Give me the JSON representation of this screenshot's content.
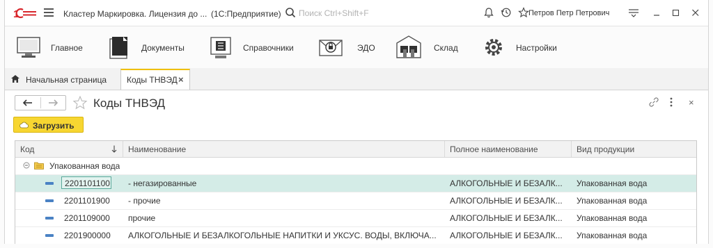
{
  "app": {
    "title": "Кластер Маркировка. Лицензия до ...",
    "subtitle": "(1С:Предприятие)",
    "search_placeholder": "Поиск Ctrl+Shift+F",
    "user": "Петров Петр Петрович"
  },
  "sections": [
    {
      "label": "Главное",
      "icon": "desktop-icon"
    },
    {
      "label": "Документы",
      "icon": "documents-icon"
    },
    {
      "label": "Справочники",
      "icon": "catalogs-icon"
    },
    {
      "label": "ЭДО",
      "icon": "edo-icon"
    },
    {
      "label": "Склад",
      "icon": "warehouse-icon"
    },
    {
      "label": "Настройки",
      "icon": "settings-gear-icon"
    }
  ],
  "tabs": {
    "home": "Начальная страница",
    "active": "Коды ТНВЭД",
    "close": "×"
  },
  "form": {
    "title": "Коды ТНВЭД",
    "load_button": "Загрузить",
    "close": "×"
  },
  "table": {
    "columns": [
      "Код",
      "Наименование",
      "Полное наименование",
      "Вид продукции"
    ],
    "group": "Упакованная вода",
    "rows": [
      {
        "code": "2201101100",
        "name": "- негазированные",
        "full": "АЛКОГОЛЬНЫЕ И БЕЗАЛК...",
        "kind": "Упакованная вода"
      },
      {
        "code": "2201101900",
        "name": "- прочие",
        "full": "АЛКОГОЛЬНЫЕ И БЕЗАЛК...",
        "kind": "Упакованная вода"
      },
      {
        "code": "2201109000",
        "name": "прочие",
        "full": "АЛКОГОЛЬНЫЕ И БЕЗАЛК...",
        "kind": "Упакованная вода"
      },
      {
        "code": "2201900000",
        "name": "АЛКОГОЛЬНЫЕ И БЕЗАЛКОГОЛЬНЫЕ НАПИТКИ И УКСУС. ВОДЫ, ВКЛЮЧА...",
        "full": "АЛКОГОЛЬНЫЕ И БЕЗАЛК...",
        "kind": "Упакованная вода"
      }
    ]
  },
  "colors": {
    "accent": "#f7d631",
    "selected_row": "#d4ece7",
    "logo_red": "#d8252b"
  }
}
